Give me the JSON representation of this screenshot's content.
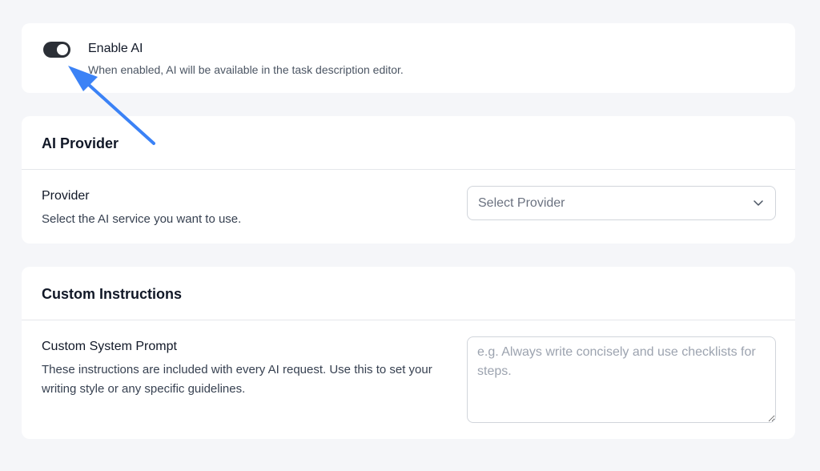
{
  "enable_ai": {
    "title": "Enable AI",
    "description": "When enabled, AI will be available in the task description editor.",
    "enabled": true
  },
  "provider_section": {
    "title": "AI Provider",
    "field_label": "Provider",
    "field_description": "Select the AI service you want to use.",
    "select_placeholder": "Select Provider",
    "chevron_icon": "chevron-down-icon"
  },
  "instructions_section": {
    "title": "Custom Instructions",
    "field_label": "Custom System Prompt",
    "field_description": "These instructions are included with every AI request. Use this to set your writing style or any specific guidelines.",
    "textarea_placeholder": "e.g. Always write concisely and use checklists for steps."
  },
  "colors": {
    "background": "#f5f6f9",
    "toggle_on": "#2b2f36",
    "annotation_arrow": "#3b82f6"
  }
}
